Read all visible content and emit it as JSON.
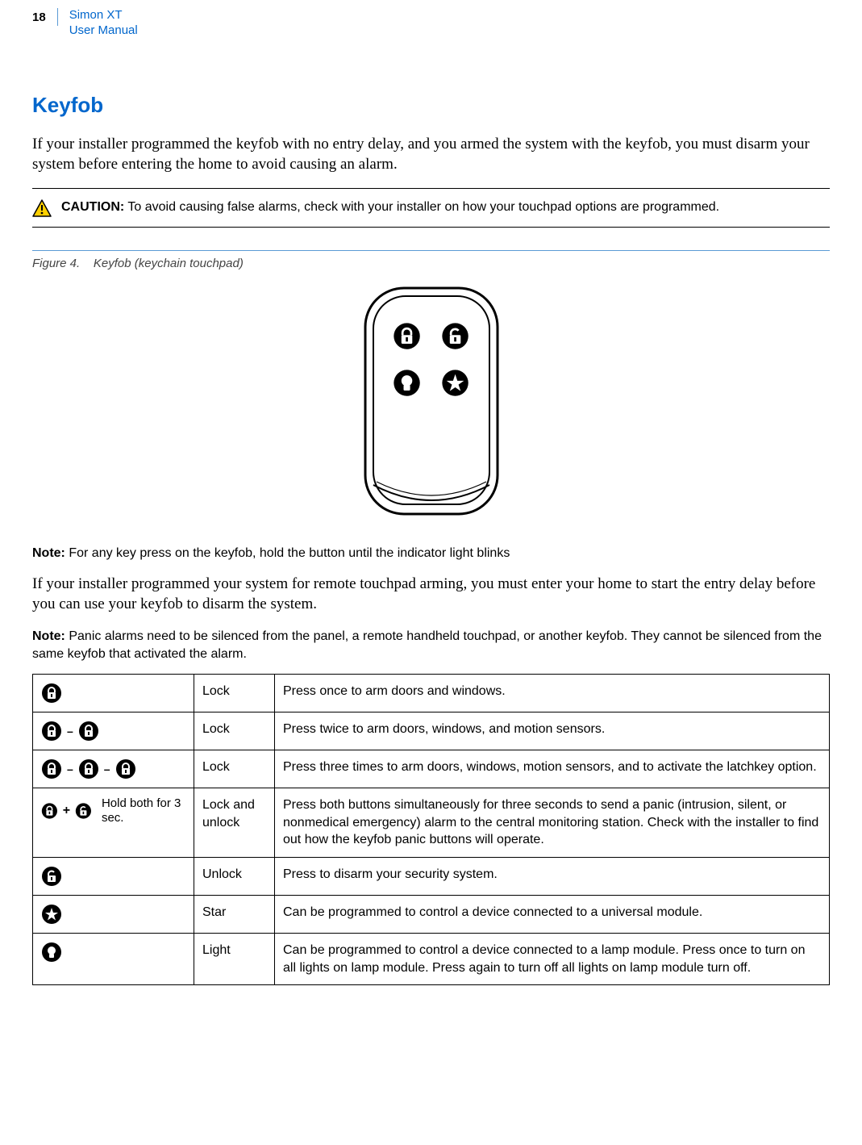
{
  "header": {
    "page_number": "18",
    "product": "Simon XT",
    "subtitle": "User Manual"
  },
  "section_title": "Keyfob",
  "intro_paragraph": "If your installer programmed the keyfob with no entry delay, and you armed the system with the keyfob, you must disarm your system before entering the home to avoid causing an alarm.",
  "caution": {
    "label": "CAUTION:",
    "text": "To avoid causing false alarms, check with your installer on how your touchpad options are programmed."
  },
  "figure": {
    "label": "Figure 4.",
    "caption": "Keyfob (keychain touchpad)"
  },
  "note1": {
    "label": "Note:",
    "text": "For any key press on the keyfob, hold the button until the indicator light blinks"
  },
  "mid_paragraph": "If your installer programmed your system for remote touchpad arming, you must enter your home to start the entry delay before you can use your keyfob to disarm the system.",
  "note2": {
    "label": "Note:",
    "text": "Panic alarms need to be silenced from the panel, a remote handheld touchpad, or another keyfob. They cannot be silenced from the same keyfob that activated the alarm."
  },
  "table": {
    "rows": [
      {
        "icon_annot": "",
        "button_name": "Lock",
        "desc": "Press once to arm doors and windows."
      },
      {
        "icon_annot": "",
        "button_name": "Lock",
        "desc": "Press twice to arm doors, windows, and motion sensors."
      },
      {
        "icon_annot": "",
        "button_name": "Lock",
        "desc": "Press three times to arm doors, windows, motion sensors, and to activate the latchkey option."
      },
      {
        "icon_annot": "Hold both for 3 sec.",
        "button_name": "Lock and unlock",
        "desc": "Press both buttons simultaneously for three seconds to send a panic (intrusion, silent, or nonmedical emergency) alarm to the central monitoring station. Check with the installer to find out how the keyfob panic buttons will operate."
      },
      {
        "icon_annot": "",
        "button_name": "Unlock",
        "desc": "Press to disarm your security system."
      },
      {
        "icon_annot": "",
        "button_name": "Star",
        "desc": "Can be programmed to control a device connected to a universal module."
      },
      {
        "icon_annot": "",
        "button_name": "Light",
        "desc": "Can be programmed to control a device connected to a lamp module. Press once to turn on all lights on lamp module. Press again to turn off all lights on lamp module turn off."
      }
    ]
  }
}
